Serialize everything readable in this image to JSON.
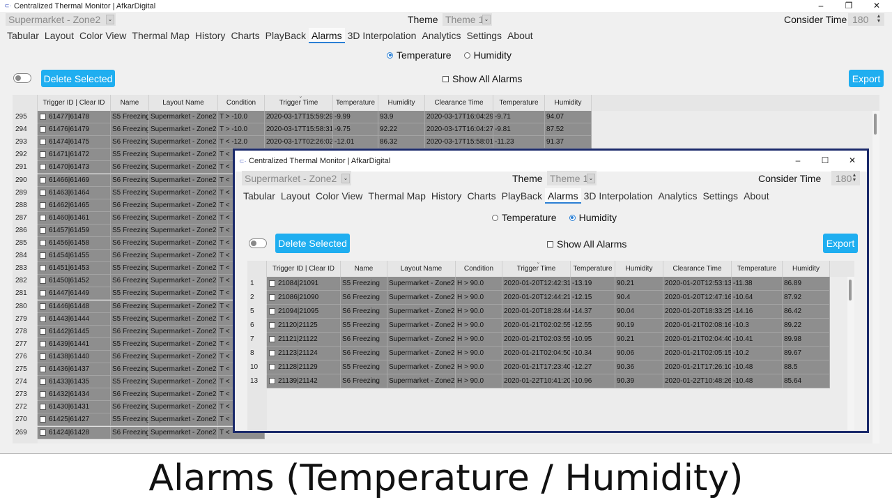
{
  "caption": "Alarms (Temperature / Humidity)",
  "main": {
    "title": "Centralized Thermal Monitor | AfkarDigital",
    "zone_value": "Supermarket - Zone2",
    "theme_label": "Theme",
    "theme_value": "Theme 1",
    "consider_label": "Consider Time",
    "consider_value": "180",
    "tabs": [
      "Tabular",
      "Layout",
      "Color View",
      "Thermal Map",
      "History",
      "Charts",
      "PlayBack",
      "Alarms",
      "3D Interpolation",
      "Analytics",
      "Settings",
      "About"
    ],
    "active_tab": "Alarms",
    "radio_temperature": "Temperature",
    "radio_humidity": "Humidity",
    "selected_radio": "Temperature",
    "delete_label": "Delete Selected",
    "show_all_label": "Show All Alarms",
    "export_label": "Export",
    "columns": [
      "Trigger ID | Clear ID",
      "Name",
      "Layout Name",
      "Condition",
      "Trigger Time",
      "Temperature",
      "Humidity",
      "Clearance Time",
      "Temperature",
      "Humidity"
    ],
    "rows": [
      [
        "295",
        "61477|61478",
        "S5 Freezing",
        "Supermarket - Zone2",
        "T > -10.0",
        "2020-03-17T15:59:29",
        "-9.99",
        "93.9",
        "2020-03-17T16:04:29",
        "-9.71",
        "94.07"
      ],
      [
        "294",
        "61476|61479",
        "S6 Freezing",
        "Supermarket - Zone2",
        "T > -10.0",
        "2020-03-17T15:58:31",
        "-9.75",
        "92.22",
        "2020-03-17T16:04:27",
        "-9.81",
        "87.52"
      ],
      [
        "293",
        "61474|61475",
        "S6 Freezing",
        "Supermarket - Zone2",
        "T < -12.0",
        "2020-03-17T02:26:02",
        "-12.01",
        "86.32",
        "2020-03-17T15:58:01",
        "-11.23",
        "91.37"
      ],
      [
        "292",
        "61471|61472",
        "S5 Freezing",
        "Supermarket - Zone2",
        "T <",
        "",
        "",
        "",
        "",
        "",
        ""
      ],
      [
        "291",
        "61470|61473",
        "S6 Freezing",
        "Supermarket - Zone2",
        "T <",
        "",
        "",
        "",
        "",
        "",
        ""
      ],
      [
        "290",
        "61466|61469",
        "S6 Freezing",
        "Supermarket - Zone2",
        "T <",
        "",
        "",
        "",
        "",
        "",
        ""
      ],
      [
        "289",
        "61463|61464",
        "S5 Freezing",
        "Supermarket - Zone2",
        "T <",
        "",
        "",
        "",
        "",
        "",
        ""
      ],
      [
        "288",
        "61462|61465",
        "S6 Freezing",
        "Supermarket - Zone2",
        "T <",
        "",
        "",
        "",
        "",
        "",
        ""
      ],
      [
        "287",
        "61460|61461",
        "S6 Freezing",
        "Supermarket - Zone2",
        "T <",
        "",
        "",
        "",
        "",
        "",
        ""
      ],
      [
        "286",
        "61457|61459",
        "S5 Freezing",
        "Supermarket - Zone2",
        "T <",
        "",
        "",
        "",
        "",
        "",
        ""
      ],
      [
        "285",
        "61456|61458",
        "S6 Freezing",
        "Supermarket - Zone2",
        "T <",
        "",
        "",
        "",
        "",
        "",
        ""
      ],
      [
        "284",
        "61454|61455",
        "S6 Freezing",
        "Supermarket - Zone2",
        "T <",
        "",
        "",
        "",
        "",
        "",
        ""
      ],
      [
        "283",
        "61451|61453",
        "S5 Freezing",
        "Supermarket - Zone2",
        "T <",
        "",
        "",
        "",
        "",
        "",
        ""
      ],
      [
        "282",
        "61450|61452",
        "S6 Freezing",
        "Supermarket - Zone2",
        "T <",
        "",
        "",
        "",
        "",
        "",
        ""
      ],
      [
        "281",
        "61447|61449",
        "S5 Freezing",
        "Supermarket - Zone2",
        "T <",
        "",
        "",
        "",
        "",
        "",
        ""
      ],
      [
        "280",
        "61446|61448",
        "S6 Freezing",
        "Supermarket - Zone2",
        "T <",
        "",
        "",
        "",
        "",
        "",
        ""
      ],
      [
        "279",
        "61443|61444",
        "S5 Freezing",
        "Supermarket - Zone2",
        "T <",
        "",
        "",
        "",
        "",
        "",
        ""
      ],
      [
        "278",
        "61442|61445",
        "S6 Freezing",
        "Supermarket - Zone2",
        "T <",
        "",
        "",
        "",
        "",
        "",
        ""
      ],
      [
        "277",
        "61439|61441",
        "S5 Freezing",
        "Supermarket - Zone2",
        "T <",
        "",
        "",
        "",
        "",
        "",
        ""
      ],
      [
        "276",
        "61438|61440",
        "S6 Freezing",
        "Supermarket - Zone2",
        "T <",
        "",
        "",
        "",
        "",
        "",
        ""
      ],
      [
        "275",
        "61436|61437",
        "S6 Freezing",
        "Supermarket - Zone2",
        "T <",
        "",
        "",
        "",
        "",
        "",
        ""
      ],
      [
        "274",
        "61433|61435",
        "S5 Freezing",
        "Supermarket - Zone2",
        "T <",
        "",
        "",
        "",
        "",
        "",
        ""
      ],
      [
        "273",
        "61432|61434",
        "S6 Freezing",
        "Supermarket - Zone2",
        "T <",
        "",
        "",
        "",
        "",
        "",
        ""
      ],
      [
        "272",
        "61430|61431",
        "S6 Freezing",
        "Supermarket - Zone2",
        "T <",
        "",
        "",
        "",
        "",
        "",
        ""
      ],
      [
        "270",
        "61425|61427",
        "S5 Freezing",
        "Supermarket - Zone2",
        "T <",
        "",
        "",
        "",
        "",
        "",
        ""
      ],
      [
        "269",
        "61424|61428",
        "S6 Freezing",
        "Supermarket - Zone2",
        "T <",
        "",
        "",
        "",
        "",
        "",
        ""
      ]
    ]
  },
  "dialog": {
    "title": "Centralized Thermal Monitor | AfkarDigital",
    "zone_value": "Supermarket - Zone2",
    "theme_label": "Theme",
    "theme_value": "Theme 1",
    "consider_label": "Consider Time",
    "consider_value": "180",
    "tabs": [
      "Tabular",
      "Layout",
      "Color View",
      "Thermal Map",
      "History",
      "Charts",
      "PlayBack",
      "Alarms",
      "3D Interpolation",
      "Analytics",
      "Settings",
      "About"
    ],
    "active_tab": "Alarms",
    "radio_temperature": "Temperature",
    "radio_humidity": "Humidity",
    "selected_radio": "Humidity",
    "delete_label": "Delete Selected",
    "show_all_label": "Show All Alarms",
    "export_label": "Export",
    "columns": [
      "Trigger ID | Clear ID",
      "Name",
      "Layout Name",
      "Condition",
      "Trigger Time",
      "Temperature",
      "Humidity",
      "Clearance Time",
      "Temperature",
      "Humidity"
    ],
    "rows": [
      [
        "1",
        "21084|21091",
        "S5 Freezing",
        "Supermarket - Zone2",
        "H > 90.0",
        "2020-01-20T12:42:31",
        "-13.19",
        "90.21",
        "2020-01-20T12:53:13",
        "-11.38",
        "86.89"
      ],
      [
        "2",
        "21086|21090",
        "S6 Freezing",
        "Supermarket - Zone2",
        "H > 90.0",
        "2020-01-20T12:44:21",
        "-12.15",
        "90.4",
        "2020-01-20T12:47:16",
        "-10.64",
        "87.92"
      ],
      [
        "5",
        "21094|21095",
        "S6 Freezing",
        "Supermarket - Zone2",
        "H > 90.0",
        "2020-01-20T18:28:44",
        "-14.37",
        "90.04",
        "2020-01-20T18:33:25",
        "-14.16",
        "86.42"
      ],
      [
        "6",
        "21120|21125",
        "S5 Freezing",
        "Supermarket - Zone2",
        "H > 90.0",
        "2020-01-21T02:02:55",
        "-12.55",
        "90.19",
        "2020-01-21T02:08:16",
        "-10.3",
        "89.22"
      ],
      [
        "7",
        "21121|21122",
        "S6 Freezing",
        "Supermarket - Zone2",
        "H > 90.0",
        "2020-01-21T02:03:55",
        "-10.95",
        "90.21",
        "2020-01-21T02:04:40",
        "-10.41",
        "89.98"
      ],
      [
        "8",
        "21123|21124",
        "S6 Freezing",
        "Supermarket - Zone2",
        "H > 90.0",
        "2020-01-21T02:04:50",
        "-10.34",
        "90.06",
        "2020-01-21T02:05:15",
        "-10.2",
        "89.67"
      ],
      [
        "10",
        "21128|21129",
        "S5 Freezing",
        "Supermarket - Zone2",
        "H > 90.0",
        "2020-01-21T17:23:40",
        "-12.27",
        "90.36",
        "2020-01-21T17:26:10",
        "-10.48",
        "88.5"
      ],
      [
        "13",
        "21139|21142",
        "S6 Freezing",
        "Supermarket - Zone2",
        "H > 90.0",
        "2020-01-22T10:41:20",
        "-10.96",
        "90.39",
        "2020-01-22T10:48:26",
        "-10.48",
        "85.64"
      ]
    ]
  },
  "colors": {
    "accent": "#1faef0",
    "tab_underline": "#2a7fd4",
    "row_fill": "#8e8e8e",
    "dialog_border": "#1b2a6b"
  }
}
